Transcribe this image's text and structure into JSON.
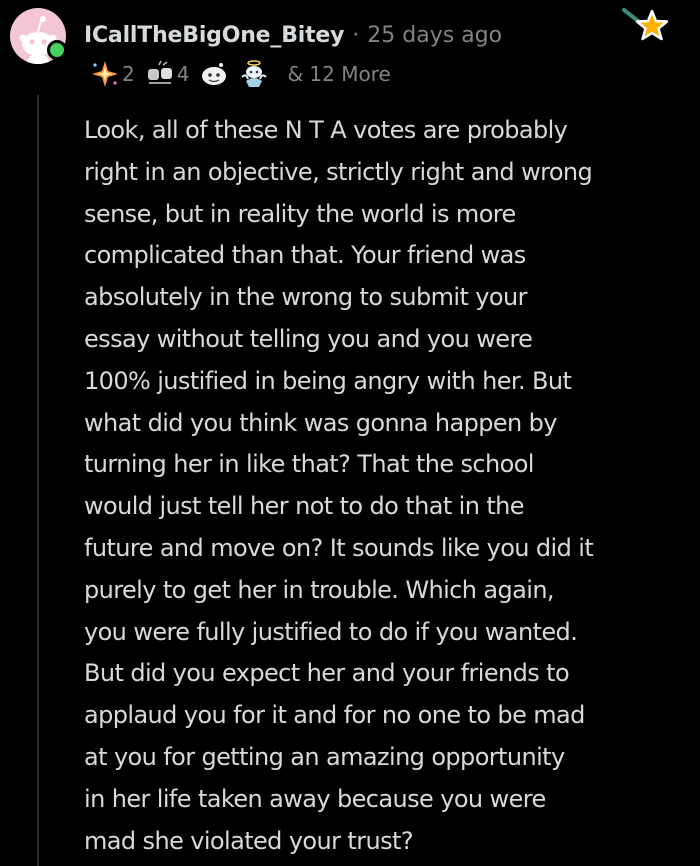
{
  "comment": {
    "author": "ICallTheBigOne_Bitey",
    "separator": "·",
    "timestamp": "25 days ago",
    "awards": [
      {
        "icon": "sparkle-award-icon",
        "count": "2"
      },
      {
        "icon": "fist-bump-award-icon",
        "count": "4"
      },
      {
        "icon": "snoo-face-award-icon",
        "count": ""
      },
      {
        "icon": "angel-snoo-award-icon",
        "count": ""
      }
    ],
    "more_awards": "& 12 More",
    "body_lines": [
      "Look, all of these N T A votes are probably",
      "right in an objective, strictly right and wrong",
      "sense, but in reality the world is more",
      "complicated than that. Your friend was",
      "absolutely in the wrong to submit your",
      "essay without telling you and you were",
      "100% justified in being angry with her. But",
      "what did you think was gonna happen by",
      "turning her in like that? That the school",
      "would just tell her not to do that in the",
      "future and move on? It sounds like you did it",
      "purely to get her in trouble. Which again,",
      "you were fully justified to do if you wanted.",
      "But did you expect her and your friends to",
      "applaud you for it and for no one to be mad",
      "at you for getting an amazing opportunity",
      "in her life taken away because you were",
      "mad she violated your trust?"
    ]
  },
  "colors": {
    "background": "#000000",
    "text": "#d7dadc",
    "muted": "#818384",
    "online": "#46d160",
    "avatar_bg": "#f4c6d3",
    "star": "#ffb000"
  }
}
